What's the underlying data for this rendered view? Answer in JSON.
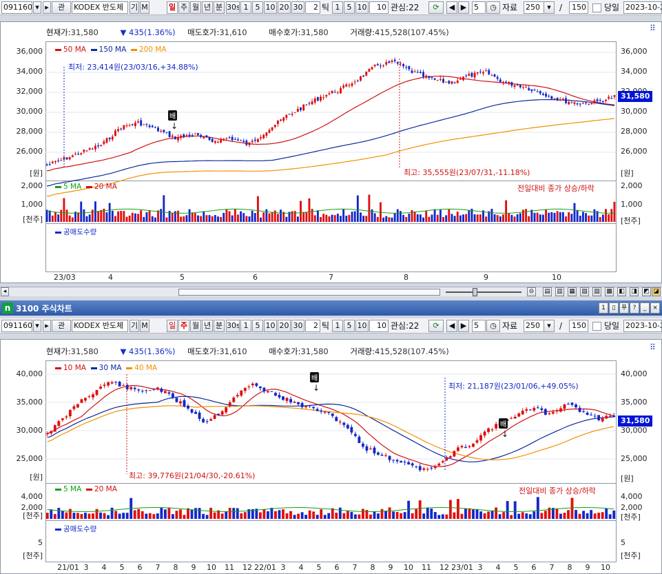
{
  "toolbar": {
    "code": "091160",
    "pan_label": "관",
    "name": "KODEX 반도체",
    "gi_label": "기",
    "m_label": "M",
    "periods": [
      "일",
      "주",
      "월",
      "년",
      "분"
    ],
    "sec_value": "30s",
    "minute_buttons": [
      "1",
      "5",
      "10",
      "20",
      "30"
    ],
    "tick_value": "2",
    "tick_label": "틱",
    "tick_buttons": [
      "1",
      "5",
      "10"
    ],
    "tick_input": "10",
    "watch_label": "관심:22",
    "page_value": "5",
    "data_label": "자료",
    "data_value": "250",
    "slash": "/",
    "max_value": "150",
    "sameday_label": "당일",
    "date_value": "2023-10-2"
  },
  "window2_title": "3100 주식차트",
  "window2_code": "n",
  "info": {
    "cur_label": "현재가:",
    "cur": "31,580",
    "chg": "▼ 435(1.36%)",
    "ask_label": "매도호가:",
    "ask": "31,610",
    "bid_label": "매수호가:",
    "bid": "31,580",
    "vol_label": "거래량:",
    "vol": "415,528(107.45%)"
  },
  "chart1": {
    "legend": [
      {
        "name": "50 MA",
        "color": "#d01010"
      },
      {
        "name": "150 MA",
        "color": "#0a2a9c"
      },
      {
        "name": "200 MA",
        "color": "#f09000"
      }
    ],
    "y_ticks": [
      "36,000",
      "34,000",
      "32,000",
      "30,000",
      "28,000",
      "26,000"
    ],
    "unit": "[원]",
    "price_tag": "31,580",
    "low_note": "최저: 23,414원(23/03/16,+34.88%)",
    "high_note": "최고: 35,555원(23/07/31,-11.18%)",
    "bae": "배",
    "vol_legend": [
      {
        "name": "5 MA",
        "color": "#10a010"
      },
      {
        "name": "20 MA",
        "color": "#d01010"
      }
    ],
    "vol_ticks": [
      "2,000",
      "1,000"
    ],
    "vol_unit": "[천주]",
    "vol_note": "전일대비 종가 상승/하락",
    "short_legend": "공매도수량",
    "x_ticks": [
      "23/03",
      "4",
      "5",
      "6",
      "7",
      "8",
      "9",
      "10"
    ]
  },
  "chart2": {
    "legend": [
      {
        "name": "10 MA",
        "color": "#d01010"
      },
      {
        "name": "30 MA",
        "color": "#0a2a9c"
      },
      {
        "name": "40 MA",
        "color": "#f09000"
      }
    ],
    "y_ticks": [
      "40,000",
      "35,000",
      "30,000",
      "25,000"
    ],
    "unit": "[원]",
    "price_tag": "31,580",
    "low_note": "최저: 21,187원(23/01/06,+49.05%)",
    "high_note": "최고: 39,776원(21/04/30,-20.61%)",
    "bae": "배",
    "vol_legend": [
      {
        "name": "5 MA",
        "color": "#10a010"
      },
      {
        "name": "20 MA",
        "color": "#d01010"
      }
    ],
    "vol_ticks": [
      "4,000",
      "2,000"
    ],
    "vol_unit": "[천주]",
    "vol_note": "전일대비 종가 상승/하락",
    "short_legend": "공매도수량",
    "short_ticks": [
      "5"
    ],
    "short_unit": "[천주]",
    "x_ticks": [
      "21/01",
      "3",
      "4",
      "5",
      "6",
      "7",
      "8",
      "9",
      "10",
      "11",
      "12",
      "22/01",
      "3",
      "4",
      "5",
      "6",
      "7",
      "8",
      "9",
      "10",
      "11",
      "12",
      "23/01",
      "3",
      "4",
      "5",
      "6",
      "7",
      "8",
      "9",
      "10"
    ]
  },
  "colors": {
    "up": "#e01010",
    "down": "#1428c8",
    "bg": "#ffffff"
  }
}
